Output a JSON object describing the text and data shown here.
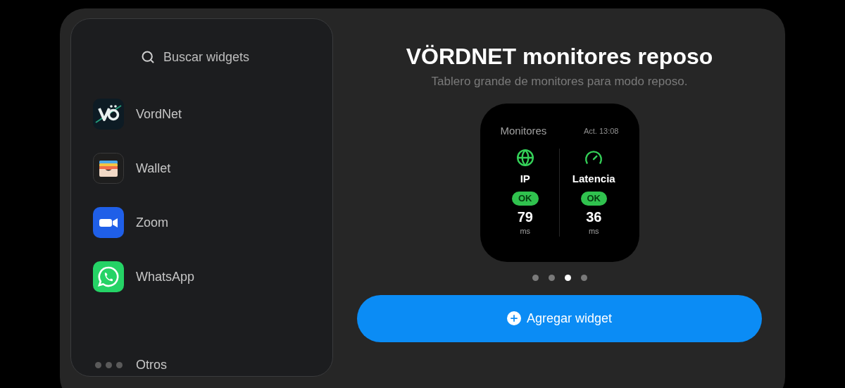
{
  "search": {
    "placeholder": "Buscar widgets"
  },
  "apps": [
    {
      "name": "VordNet",
      "kind": "vordnet"
    },
    {
      "name": "Wallet",
      "kind": "wallet"
    },
    {
      "name": "Zoom",
      "kind": "zoom"
    },
    {
      "name": "WhatsApp",
      "kind": "whatsapp"
    }
  ],
  "more": {
    "label": "Otros"
  },
  "widget_title": "VÖRDNET monitores reposo",
  "widget_subtitle": "Tablero grande de monitores para modo reposo.",
  "widget": {
    "title": "Monitores",
    "updated": "Act. 13:08",
    "monitors": [
      {
        "name": "IP",
        "kind": "globe",
        "status": "OK",
        "value": "79",
        "unit": "ms"
      },
      {
        "name": "Latencia",
        "kind": "gauge",
        "status": "OK",
        "value": "36",
        "unit": "ms"
      }
    ]
  },
  "pages": [
    {
      "selected": false
    },
    {
      "selected": false
    },
    {
      "selected": true
    },
    {
      "selected": false
    }
  ],
  "add_button": {
    "label": "Agregar widget"
  }
}
